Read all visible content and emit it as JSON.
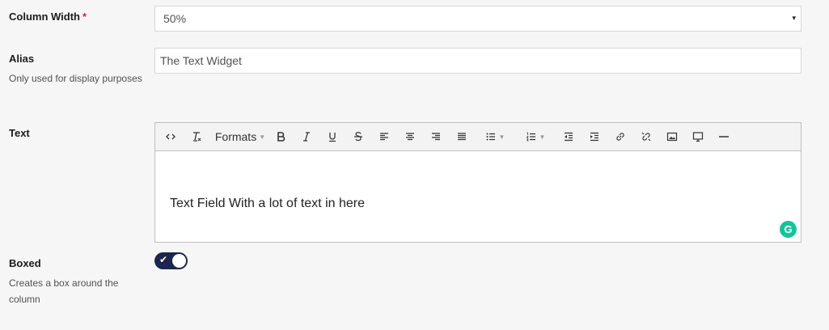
{
  "column_width": {
    "label": "Column Width",
    "required_mark": "*",
    "value": "50%",
    "caret": "▾"
  },
  "alias": {
    "label": "Alias",
    "description": "Only used for display purposes",
    "value": "The Text Widget"
  },
  "text": {
    "label": "Text",
    "toolbar": {
      "formats_label": "Formats",
      "items": [
        "code-icon",
        "clear-formatting-icon",
        "formats-dropdown",
        "bold-icon",
        "italic-icon",
        "underline-icon",
        "strikethrough-icon",
        "align-left-icon",
        "align-center-icon",
        "align-right-icon",
        "align-justify-icon",
        "bullet-list-icon",
        "numbered-list-icon",
        "outdent-icon",
        "indent-icon",
        "link-icon",
        "unlink-icon",
        "image-icon",
        "media-icon",
        "horizontal-rule-icon"
      ]
    },
    "content": "Text Field With a lot of text in here",
    "grammarly_letter": "G"
  },
  "boxed": {
    "label": "Boxed",
    "description": "Creates a box around the column",
    "enabled": true,
    "check": "✔"
  },
  "colors": {
    "toggle_on": "#1b264f",
    "required": "#d42054",
    "grammarly": "#15c39a"
  }
}
